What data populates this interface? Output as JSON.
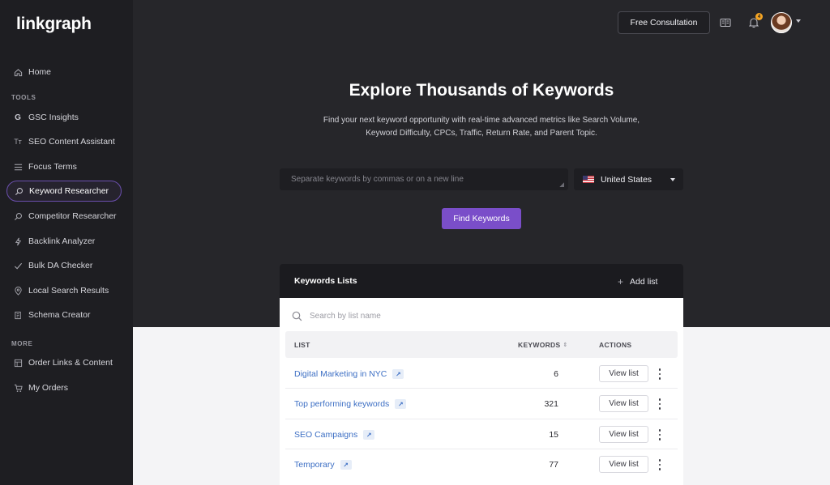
{
  "brand": {
    "logo": "linkgraph"
  },
  "sidebar": {
    "home": {
      "label": "Home",
      "icon": "home-icon"
    },
    "tools_label": "TOOLS",
    "tools": [
      {
        "label": "GSC Insights",
        "icon": "google-icon"
      },
      {
        "label": "SEO Content Assistant",
        "icon": "text-size-icon"
      },
      {
        "label": "Focus Terms",
        "icon": "list-icon"
      },
      {
        "label": "Keyword Researcher",
        "icon": "search-icon",
        "active": true
      },
      {
        "label": "Competitor Researcher",
        "icon": "search-icon"
      },
      {
        "label": "Backlink Analyzer",
        "icon": "lightning-icon"
      },
      {
        "label": "Bulk DA Checker",
        "icon": "check-icon"
      },
      {
        "label": "Local Search Results",
        "icon": "location-pin-icon"
      },
      {
        "label": "Schema Creator",
        "icon": "document-icon"
      }
    ],
    "more_label": "MORE",
    "more": [
      {
        "label": "Order Links & Content",
        "icon": "order-icon"
      },
      {
        "label": "My Orders",
        "icon": "cart-icon"
      }
    ]
  },
  "header": {
    "consult_label": "Free Consultation",
    "notification_count": "4"
  },
  "hero": {
    "title": "Explore Thousands of Keywords",
    "subtitle": "Find your next keyword opportunity with real-time advanced metrics like Search Volume, Keyword Difficulty, CPCs, Traffic, Return Rate, and Parent Topic.",
    "input_placeholder": "Separate keywords by commas or on a new line",
    "country": "United States",
    "find_label": "Find Keywords"
  },
  "lists": {
    "title": "Keywords Lists",
    "add_label": "Add list",
    "search_placeholder": "Search by list name",
    "columns": {
      "list": "LIST",
      "keywords": "KEYWORDS",
      "actions": "ACTIONS"
    },
    "rows": [
      {
        "name": "Digital Marketing in NYC",
        "count": "6",
        "action": "View list"
      },
      {
        "name": "Top performing keywords",
        "count": "321",
        "action": "View list"
      },
      {
        "name": "SEO Campaigns",
        "count": "15",
        "action": "View list"
      },
      {
        "name": "Temporary",
        "count": "77",
        "action": "View list"
      }
    ]
  },
  "colors": {
    "accent": "#7a4ec9",
    "sidebar_bg": "#1e1e22",
    "hero_bg": "#26262a",
    "link": "#3d6fc4"
  }
}
